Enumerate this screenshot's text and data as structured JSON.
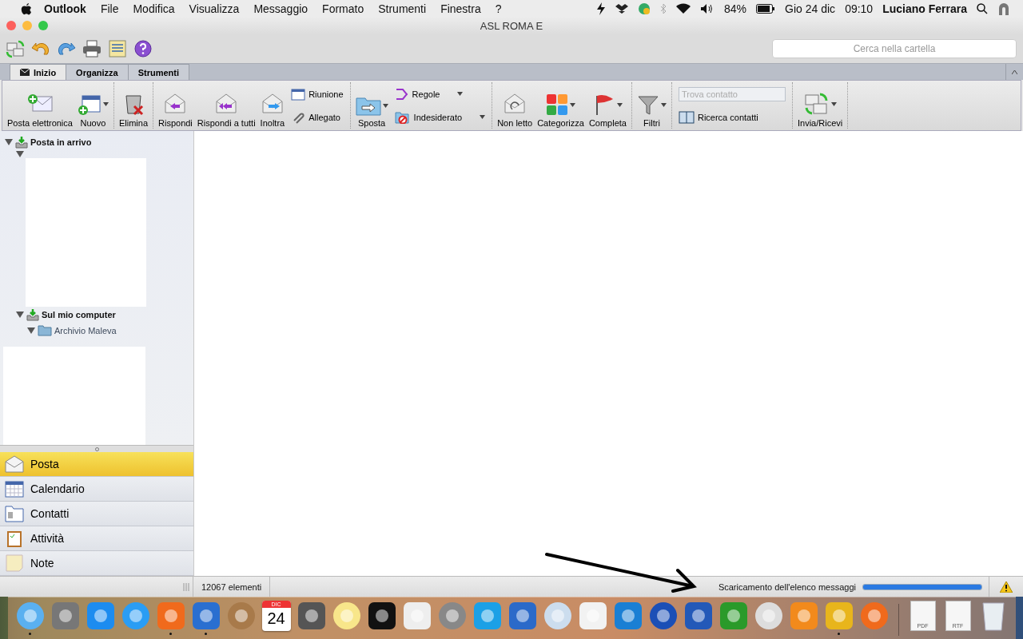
{
  "menubar": {
    "app": "Outlook",
    "menus": [
      "File",
      "Modifica",
      "Visualizza",
      "Messaggio",
      "Formato",
      "Strumenti",
      "Finestra",
      "?"
    ],
    "battery_percent": "84%",
    "date": "Gio 24 dic",
    "time": "09:10",
    "user": "Luciano Ferrara"
  },
  "window": {
    "title": "ASL ROMA E",
    "search": {
      "placeholder": "Cerca nella cartella"
    }
  },
  "tabs": [
    {
      "label": "Inizio",
      "selected": true
    },
    {
      "label": "Organizza",
      "selected": false
    },
    {
      "label": "Strumenti",
      "selected": false
    }
  ],
  "ribbon": [
    {
      "items": [
        {
          "kind": "large",
          "label": "Posta elettronica",
          "dropdown": false
        },
        {
          "kind": "large",
          "label": "Nuovo",
          "dropdown": true
        }
      ]
    },
    {
      "items": [
        {
          "kind": "large",
          "label": "Elimina",
          "dropdown": false
        }
      ]
    },
    {
      "items": [
        {
          "kind": "large",
          "label": "Rispondi",
          "dropdown": false
        },
        {
          "kind": "large",
          "label": "Rispondi a tutti",
          "dropdown": false
        },
        {
          "kind": "large",
          "label": "Inoltra",
          "dropdown": false
        },
        {
          "kind": "stack",
          "buttons": [
            {
              "kind": "button",
              "label": "Riunione",
              "dropdown": false
            },
            {
              "kind": "button",
              "label": "Allegato",
              "dropdown": false
            }
          ]
        }
      ]
    },
    {
      "items": [
        {
          "kind": "large",
          "label": "Sposta",
          "dropdown": true
        },
        {
          "kind": "stack",
          "buttons": [
            {
              "kind": "button",
              "label": "Regole",
              "dropdown": true
            },
            {
              "kind": "button",
              "label": "Indesiderato",
              "dropdown": true
            }
          ]
        }
      ]
    },
    {
      "items": [
        {
          "kind": "large",
          "label": "Non letto",
          "dropdown": false
        },
        {
          "kind": "large",
          "label": "Categorizza",
          "dropdown": true
        },
        {
          "kind": "large",
          "label": "Completa",
          "dropdown": true
        }
      ]
    },
    {
      "items": [
        {
          "kind": "large",
          "label": "Filtri",
          "dropdown": true
        }
      ]
    },
    {
      "items": [
        {
          "kind": "stack",
          "buttons": [
            {
              "kind": "field",
              "placeholder": "Trova contatto"
            },
            {
              "kind": "button",
              "label": "Ricerca contatti",
              "dropdown": false
            }
          ]
        }
      ]
    },
    {
      "items": [
        {
          "kind": "large",
          "label": "Invia/Ricevi",
          "dropdown": true
        }
      ]
    }
  ],
  "folders": [
    {
      "kind": "folder",
      "label": "Posta in arrivo",
      "expanded": true,
      "children": [
        {
          "kind": "hidden",
          "expanded": true
        },
        {
          "kind": "folder",
          "label": "Sul mio computer",
          "expanded": true,
          "children": [
            {
              "kind": "folder",
              "label": "Archivio Maleva",
              "expanded": true,
              "children": [
                {
                  "kind": "hidden"
                }
              ]
            }
          ]
        }
      ]
    }
  ],
  "nav": [
    {
      "label": "Posta",
      "selected": true
    },
    {
      "label": "Calendario",
      "selected": false
    },
    {
      "label": "Contatti",
      "selected": false
    },
    {
      "label": "Attività",
      "selected": false
    },
    {
      "label": "Note",
      "selected": false
    }
  ],
  "status_bar": {
    "count": "12067 elementi",
    "activity": "Scaricamento dell'elenco messaggi",
    "progress": {
      "level": 1.0
    }
  },
  "dock": [
    {
      "kind": "app",
      "running": true
    },
    {
      "kind": "app",
      "running": false
    },
    {
      "kind": "app",
      "running": false
    },
    {
      "kind": "app",
      "running": false
    },
    {
      "kind": "app",
      "running": true
    },
    {
      "kind": "app",
      "running": true
    },
    {
      "kind": "app",
      "running": false
    },
    {
      "kind": "calendar",
      "month": "DIC",
      "day": "24",
      "running": false
    },
    {
      "kind": "app",
      "running": false
    },
    {
      "kind": "app",
      "running": false
    },
    {
      "kind": "app",
      "running": false
    },
    {
      "kind": "app",
      "running": false
    },
    {
      "kind": "app",
      "running": false
    },
    {
      "kind": "app",
      "running": false
    },
    {
      "kind": "app",
      "running": false
    },
    {
      "kind": "app",
      "running": false
    },
    {
      "kind": "app",
      "running": false
    },
    {
      "kind": "app",
      "running": false
    },
    {
      "kind": "app",
      "running": false
    },
    {
      "kind": "app",
      "running": false
    },
    {
      "kind": "app",
      "running": false
    },
    {
      "kind": "app",
      "running": false
    },
    {
      "kind": "app",
      "running": false
    },
    {
      "kind": "app",
      "running": true
    },
    {
      "kind": "app",
      "running": false
    },
    {
      "kind": "separator"
    },
    {
      "kind": "document",
      "label": "PDF",
      "running": false
    },
    {
      "kind": "document",
      "label": "RTF",
      "running": false
    },
    {
      "kind": "trash",
      "running": false
    }
  ]
}
